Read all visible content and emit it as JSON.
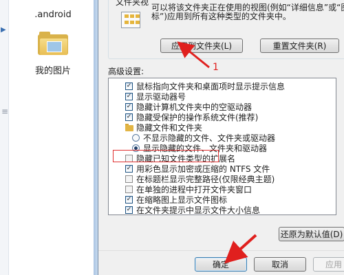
{
  "explorer": {
    "items": [
      {
        "label": ".android",
        "icon": "folder-icon"
      },
      {
        "label": "我的图片",
        "icon": "pictures-folder-icon"
      }
    ]
  },
  "dialog": {
    "view_group": {
      "title": "文件夹视",
      "description": "可以将该文件夹正在使用的视图(例如“详细信息”或“图标”)应用到所有这种类型的文件夹中。",
      "apply_button": "应用到文件夹(L)",
      "reset_button": "重置文件夹(R)"
    },
    "advanced_label": "高级设置:",
    "advanced_items": [
      {
        "kind": "checkbox",
        "checked": true,
        "label": "鼠标指向文件夹和桌面项时显示提示信息"
      },
      {
        "kind": "checkbox",
        "checked": true,
        "label": "显示驱动器号"
      },
      {
        "kind": "checkbox",
        "checked": true,
        "label": "隐藏计算机文件夹中的空驱动器"
      },
      {
        "kind": "checkbox",
        "checked": true,
        "label": "隐藏受保护的操作系统文件(推荐)"
      },
      {
        "kind": "folder",
        "label": "隐藏文件和文件夹"
      },
      {
        "kind": "radio",
        "checked": false,
        "label": "不显示隐藏的文件、文件夹或驱动器"
      },
      {
        "kind": "radio",
        "checked": true,
        "label": "显示隐藏的文件、文件夹和驱动器"
      },
      {
        "kind": "checkbox",
        "checked": false,
        "label": "隐藏已知文件类型的扩展名"
      },
      {
        "kind": "checkbox",
        "checked": true,
        "label": "用彩色显示加密或压缩的 NTFS 文件"
      },
      {
        "kind": "checkbox",
        "checked": false,
        "label": "在标题栏显示完整路径(仅限经典主题)"
      },
      {
        "kind": "checkbox",
        "checked": false,
        "label": "在单独的进程中打开文件夹窗口"
      },
      {
        "kind": "checkbox",
        "checked": true,
        "label": "在缩略图上显示文件图标"
      },
      {
        "kind": "checkbox",
        "checked": true,
        "label": "在文件夹提示中显示文件大小信息"
      }
    ],
    "restore_button": "还原为默认值(D)",
    "ok_button": "确定",
    "cancel_button": "取消",
    "apply_button": "应用"
  },
  "annotation": {
    "number": "1",
    "color": "#e0201e"
  }
}
